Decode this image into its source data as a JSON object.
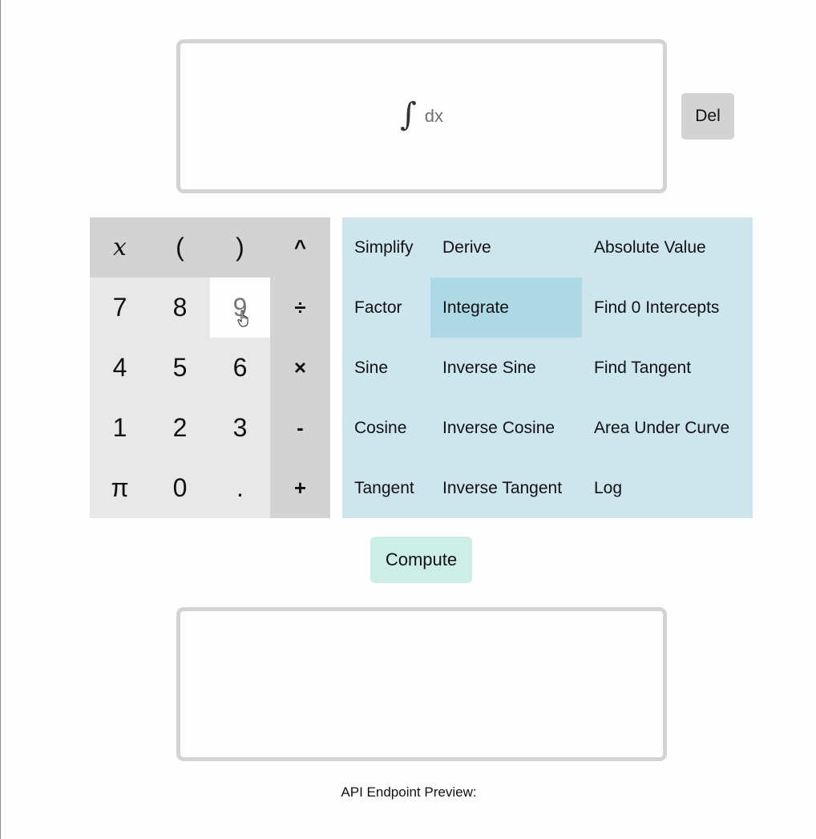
{
  "input": {
    "integral_symbol": "∫",
    "differential": "dx"
  },
  "del_button": {
    "label": "Del"
  },
  "keypad": {
    "keys": [
      {
        "label": "x",
        "kind": "top",
        "italic": true,
        "name": "key-x"
      },
      {
        "label": "(",
        "kind": "top",
        "name": "key-open-paren"
      },
      {
        "label": ")",
        "kind": "top",
        "name": "key-close-paren"
      },
      {
        "label": "^",
        "kind": "op",
        "name": "key-power"
      },
      {
        "label": "7",
        "kind": "digit",
        "name": "key-7"
      },
      {
        "label": "8",
        "kind": "digit",
        "name": "key-8"
      },
      {
        "label": "9",
        "kind": "digit",
        "hovered": true,
        "name": "key-9"
      },
      {
        "label": "÷",
        "kind": "op",
        "name": "key-divide"
      },
      {
        "label": "4",
        "kind": "digit",
        "name": "key-4"
      },
      {
        "label": "5",
        "kind": "digit",
        "name": "key-5"
      },
      {
        "label": "6",
        "kind": "digit",
        "name": "key-6"
      },
      {
        "label": "×",
        "kind": "op",
        "name": "key-multiply"
      },
      {
        "label": "1",
        "kind": "digit",
        "name": "key-1"
      },
      {
        "label": "2",
        "kind": "digit",
        "name": "key-2"
      },
      {
        "label": "3",
        "kind": "digit",
        "name": "key-3"
      },
      {
        "label": "-",
        "kind": "op",
        "name": "key-minus"
      },
      {
        "label": "π",
        "kind": "digit",
        "name": "key-pi"
      },
      {
        "label": "0",
        "kind": "digit",
        "name": "key-0"
      },
      {
        "label": ".",
        "kind": "digit",
        "name": "key-decimal"
      },
      {
        "label": "+",
        "kind": "op",
        "name": "key-plus"
      }
    ]
  },
  "functions": {
    "items": [
      {
        "label": "Simplify",
        "name": "fn-simplify"
      },
      {
        "label": "Derive",
        "name": "fn-derive"
      },
      {
        "label": "Absolute Value",
        "name": "fn-absolute-value"
      },
      {
        "label": "Factor",
        "name": "fn-factor"
      },
      {
        "label": "Integrate",
        "name": "fn-integrate",
        "active": true
      },
      {
        "label": "Find 0 Intercepts",
        "name": "fn-find-zero-intercepts"
      },
      {
        "label": "Sine",
        "name": "fn-sine"
      },
      {
        "label": "Inverse Sine",
        "name": "fn-inverse-sine"
      },
      {
        "label": "Find Tangent",
        "name": "fn-find-tangent"
      },
      {
        "label": "Cosine",
        "name": "fn-cosine"
      },
      {
        "label": "Inverse Cosine",
        "name": "fn-inverse-cosine"
      },
      {
        "label": "Area Under Curve",
        "name": "fn-area-under-curve"
      },
      {
        "label": "Tangent",
        "name": "fn-tangent"
      },
      {
        "label": "Inverse Tangent",
        "name": "fn-inverse-tangent"
      },
      {
        "label": "Log",
        "name": "fn-log"
      }
    ]
  },
  "compute_button": {
    "label": "Compute"
  },
  "output": {
    "value": ""
  },
  "api_preview": {
    "label": "API Endpoint Preview:"
  }
}
